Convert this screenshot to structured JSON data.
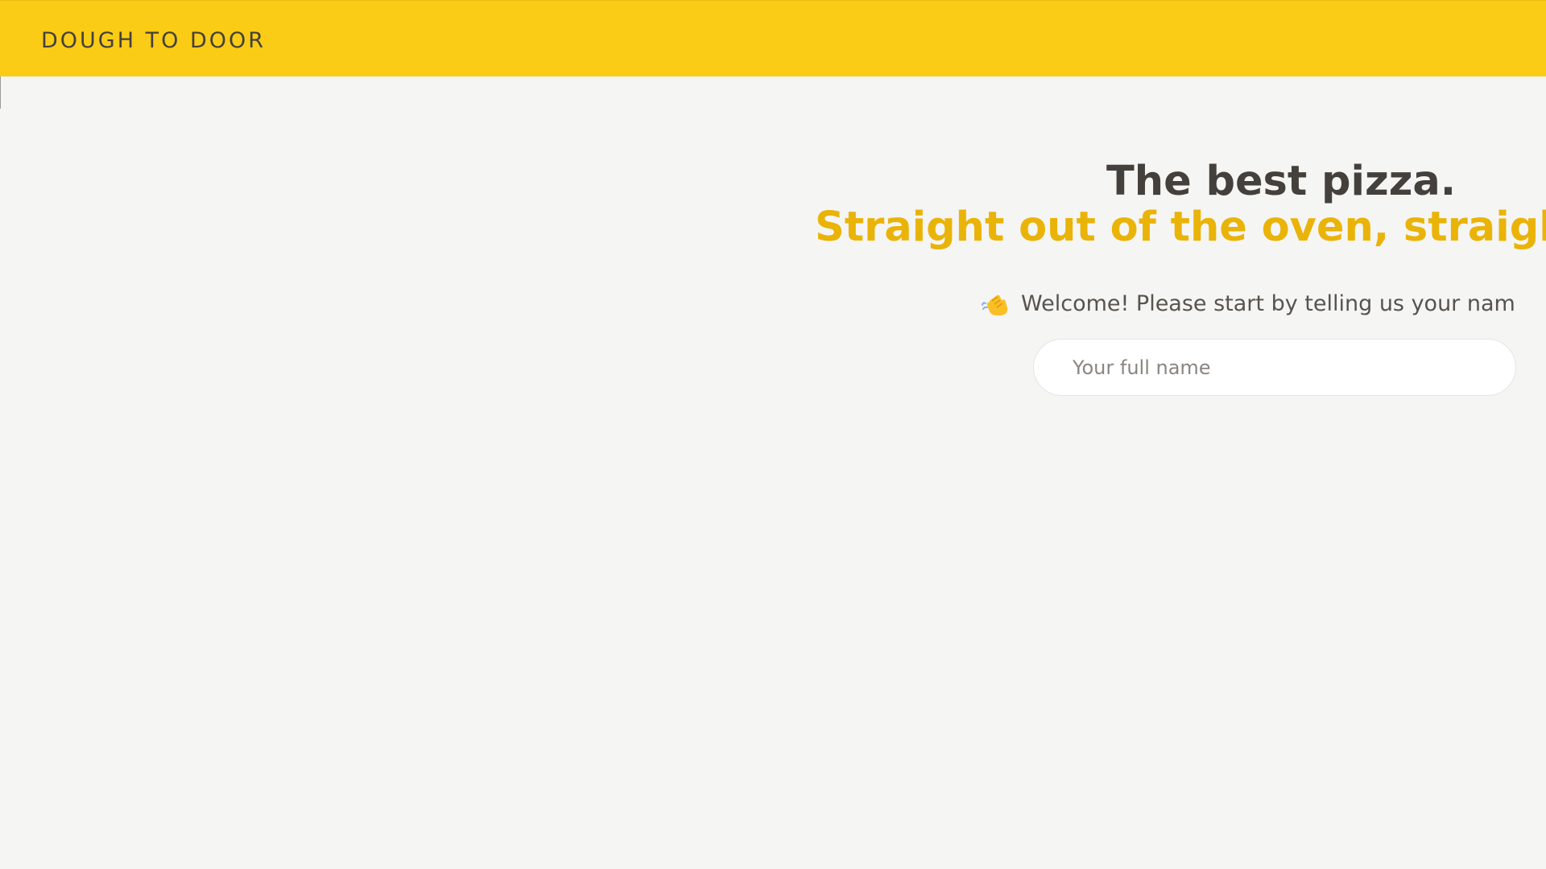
{
  "header": {
    "logo_text": "DOUGH TO DOOR",
    "background_color": "#facc15"
  },
  "hero": {
    "headline_line1": "The best pizza.",
    "headline_line2": "Straight out of the oven, straight",
    "headline_line2_color": "#eab308"
  },
  "welcome": {
    "icon": "waving-hand-icon",
    "text": "Welcome! Please start by telling us your nam"
  },
  "name_field": {
    "value": "",
    "placeholder": "Your full name"
  }
}
